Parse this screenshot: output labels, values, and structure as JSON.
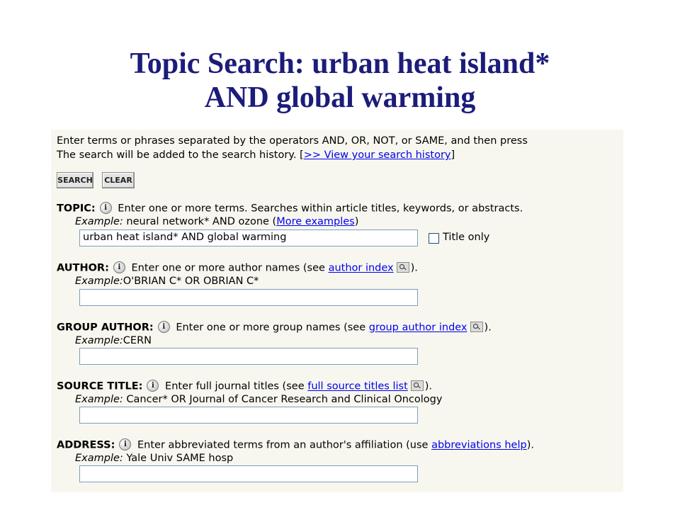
{
  "slide": {
    "title_line1": "Topic Search: urban heat island*",
    "title_line2": "AND global warming"
  },
  "form": {
    "intro_line1": "Enter terms or phrases separated by the operators AND, OR, NOT, or SAME, and then press",
    "intro_line2_prefix": "The search will be added to the search history. [",
    "history_link": ">> View your search history",
    "intro_line2_suffix": "]",
    "search_button": "SEARCH",
    "clear_button": "CLEAR",
    "info_glyph": "i",
    "example_label": "Example:",
    "topic": {
      "label": "TOPIC:",
      "description": "Enter one or more terms. Searches within article titles, keywords, or abstracts.",
      "example_text": "neural network* AND ozone (",
      "example_link": "More examples",
      "example_suffix": ")",
      "value": "urban heat island* AND global warming",
      "title_only_label": "Title only"
    },
    "author": {
      "label": "AUTHOR:",
      "description_prefix": "Enter one or more author names (see",
      "link": "author index",
      "description_suffix": ").",
      "example_text": "O'BRIAN C* OR OBRIAN C*",
      "value": ""
    },
    "group_author": {
      "label": "GROUP AUTHOR:",
      "description_prefix": "Enter one or more group names (see",
      "link": "group author index",
      "description_suffix": ").",
      "example_text": "CERN",
      "value": ""
    },
    "source_title": {
      "label": "SOURCE TITLE:",
      "description_prefix": "Enter full journal titles (see",
      "link": "full source titles list",
      "description_suffix": ").",
      "example_text": "Cancer* OR Journal of Cancer Research and Clinical Oncology",
      "value": ""
    },
    "address": {
      "label": "ADDRESS:",
      "description_prefix": "Enter abbreviated terms from an author's affiliation (use",
      "link": "abbreviations help",
      "description_suffix": ").",
      "example_text": "Yale Univ SAME hosp",
      "value": ""
    }
  },
  "icons": {
    "info": "info-icon",
    "index_lookup": "magnifier-index-icon"
  }
}
